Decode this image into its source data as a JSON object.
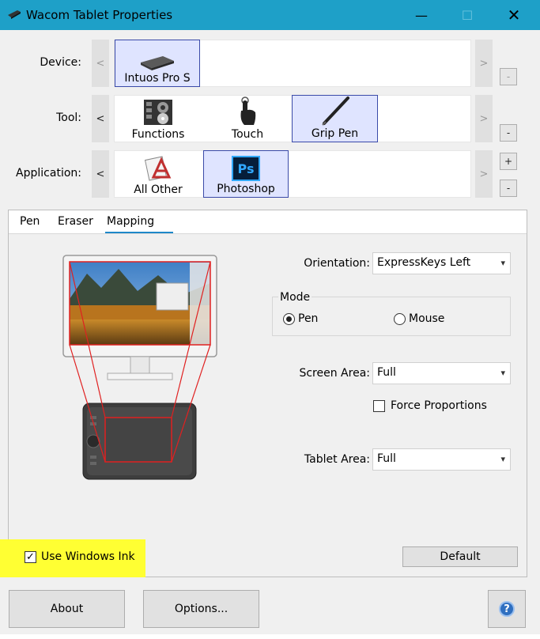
{
  "window": {
    "title": "Wacom Tablet Properties",
    "minimize": "—",
    "maximize": "☐",
    "close": "✕"
  },
  "device": {
    "label": "Device:",
    "prev": "<",
    "next": ">",
    "remove": "-",
    "items": [
      {
        "label": "Intuos Pro S",
        "icon": "tablet-icon",
        "selected": true
      }
    ]
  },
  "tool": {
    "label": "Tool:",
    "prev": "<",
    "next": ">",
    "remove": "-",
    "items": [
      {
        "label": "Functions",
        "icon": "functions-icon",
        "selected": false
      },
      {
        "label": "Touch",
        "icon": "touch-icon",
        "selected": false
      },
      {
        "label": "Grip Pen",
        "icon": "pen-icon",
        "selected": true
      }
    ]
  },
  "application": {
    "label": "Application:",
    "prev": "<",
    "next": ">",
    "add": "+",
    "remove": "-",
    "items": [
      {
        "label": "All Other",
        "icon": "all-other-icon",
        "selected": false
      },
      {
        "label": "Photoshop",
        "icon": "photoshop-icon",
        "selected": true,
        "badge": "Ps"
      }
    ]
  },
  "tabs": [
    {
      "label": "Pen",
      "active": false
    },
    {
      "label": "Eraser",
      "active": false
    },
    {
      "label": "Mapping",
      "active": true
    }
  ],
  "mapping": {
    "orientation": {
      "label": "Orientation:",
      "value": "ExpressKeys Left"
    },
    "mode": {
      "title": "Mode",
      "options": [
        {
          "label": "Pen",
          "selected": true
        },
        {
          "label": "Mouse",
          "selected": false
        }
      ]
    },
    "screen_area": {
      "label": "Screen Area:",
      "value": "Full"
    },
    "force_proportions": {
      "label": "Force Proportions",
      "checked": false
    },
    "tablet_area": {
      "label": "Tablet Area:",
      "value": "Full"
    },
    "use_windows_ink": {
      "label": "Use Windows Ink",
      "checked": true
    },
    "default_button": "Default"
  },
  "footer": {
    "about": "About",
    "options": "Options...",
    "help": "?"
  },
  "colors": {
    "titlebar": "#1ea0c8",
    "selected_tile": "#dfe4ff",
    "selected_border": "#3a4aa8",
    "highlight": "#ffff33",
    "map_lines": "#e02020"
  }
}
